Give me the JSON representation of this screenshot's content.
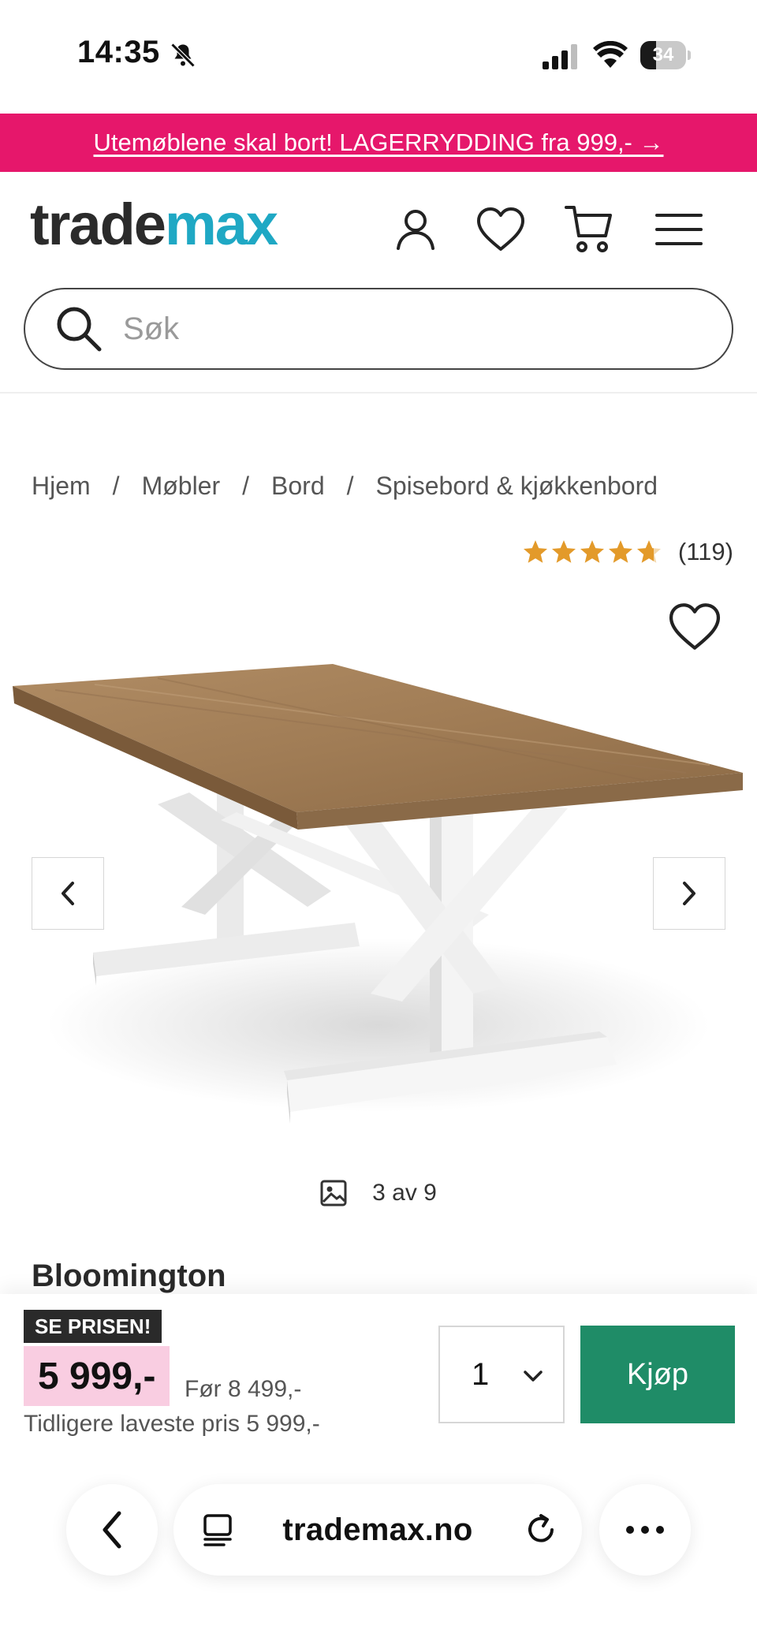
{
  "status_bar": {
    "time": "14:35",
    "battery": "34",
    "battery_level": 0.34
  },
  "promo": {
    "text": "Utemøblene skal bort! LAGERRYDDING fra 999,- →"
  },
  "header": {
    "logo_part1": "trade",
    "logo_part2": "max",
    "icons": [
      "account-icon",
      "heart-icon",
      "cart-icon",
      "menu-icon"
    ]
  },
  "search": {
    "placeholder": "Søk"
  },
  "breadcrumb": [
    "Hjem",
    "Møbler",
    "Bord",
    "Spisebord & kjøkkenbord"
  ],
  "breadcrumb_separator": "/",
  "rating": {
    "value": 4.7,
    "count": "(119)"
  },
  "gallery": {
    "counter": "3 av 9"
  },
  "product": {
    "title": "Bloomington"
  },
  "buybar": {
    "badge": "SE PRISEN!",
    "price": "5 999,-",
    "before": "Før 8 499,-",
    "lowest": "Tidligere laveste pris 5 999,-",
    "quantity": "1",
    "buy_label": "Kjøp"
  },
  "browser": {
    "url": "trademax.no"
  },
  "colors": {
    "promo": "#e6176b",
    "logo_accent": "#1fa8c4",
    "buy_button": "#1f8c67",
    "price_highlight": "#f9cde1",
    "star": "#e39a2a"
  }
}
